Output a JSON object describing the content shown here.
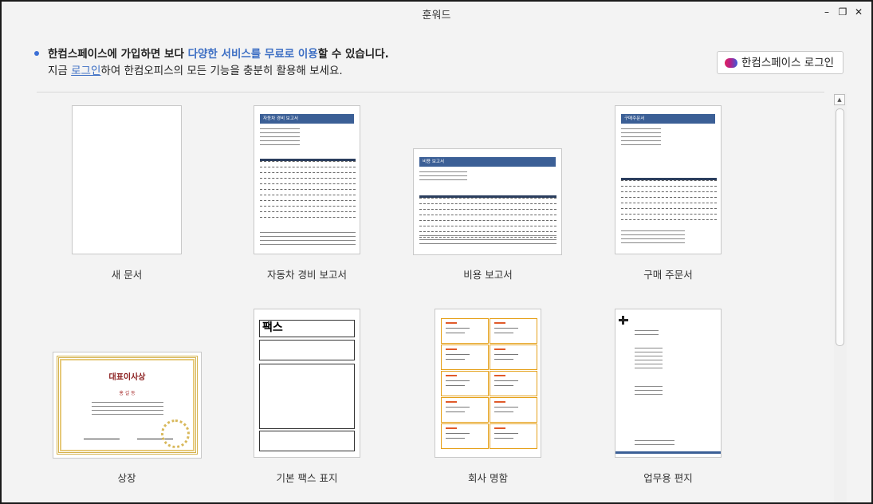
{
  "window": {
    "title": "훈워드",
    "minimize_glyph": "–",
    "restore_glyph": "❐",
    "close_glyph": "✕"
  },
  "banner": {
    "line1_part1": "한컴스페이스에 가입하면 보다 ",
    "line1_highlight": "다양한 서비스를 무료로 이용",
    "line1_part2": "할 수 있습니다.",
    "line2_part1": "지금 ",
    "line2_link": "로그인",
    "line2_part2": "하여 한컴오피스의 모든 기능을 충분히 활용해 보세요."
  },
  "login_button": {
    "label": "한컴스페이스 로그인",
    "icon": "hancom-space-logo-icon"
  },
  "templates": [
    {
      "label": "새 문서"
    },
    {
      "label": "자동차 경비 보고서",
      "heading": "자동차 경비 보고서"
    },
    {
      "label": "비용 보고서",
      "heading": "비용 보고서"
    },
    {
      "label": "구매 주문서",
      "heading": "구매주문서"
    },
    {
      "label": "상장",
      "heading": "대표이사상",
      "subheading": "홍 길 동"
    },
    {
      "label": "기본 팩스 표지",
      "heading": "팩스"
    },
    {
      "label": "회사 명함"
    },
    {
      "label": "업무용 편지"
    }
  ],
  "scrollbar": {
    "up_glyph": "▲"
  },
  "colors": {
    "accent": "#3d6fc4",
    "doc_header": "#3b5f96",
    "card_border": "#e5a019"
  }
}
